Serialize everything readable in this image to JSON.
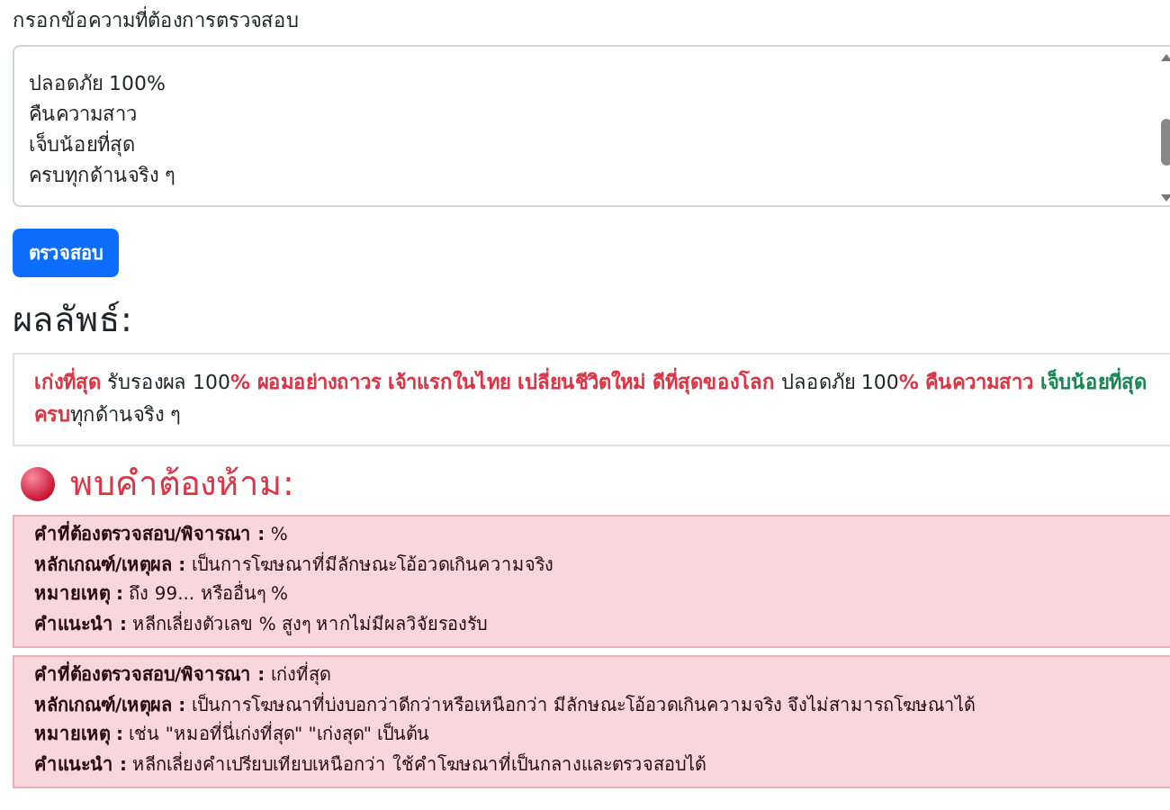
{
  "input": {
    "label": "กรอกข้อความที่ต้องการตรวจสอบ",
    "lines": [
      "ปลอดภัย 100%",
      "คืนความสาว",
      "เจ็บน้อยที่สุด",
      "ครบทุกด้านจริง ๆ"
    ]
  },
  "check_button": "ตรวจสอบ",
  "result": {
    "heading": "ผลลัพธ์:",
    "segments": [
      {
        "text": "เก่งที่สุด",
        "kind": "forbidden"
      },
      {
        "text": " รับรองผล 100",
        "kind": "plain"
      },
      {
        "text": "% ผอมอย่างถาวร เจ้าแรกในไทย เปลี่ยนชีวิตใหม่ ดีที่สุดของโลก",
        "kind": "forbidden"
      },
      {
        "text": " ปลอดภัย 100",
        "kind": "plain"
      },
      {
        "text": "% คืนความสาว",
        "kind": "forbidden"
      },
      {
        "text": " เจ็บน้อยที่สุด",
        "kind": "caution"
      },
      {
        "text": " ครบ",
        "kind": "forbidden"
      },
      {
        "text": "ทุกด้านจริง ๆ",
        "kind": "plain"
      }
    ]
  },
  "findings": {
    "heading": "พบคำต้องห้าม:",
    "items": [
      {
        "fields": [
          {
            "label": "คำที่ต้องตรวจสอบ/พิจารณา :",
            "value": "%"
          },
          {
            "label": "หลักเกณฑ์/เหตุผล :",
            "value": "เป็นการโฆษณาที่มีลักษณะโอ้อวดเกินความจริง"
          },
          {
            "label": "หมายเหตุ :",
            "value": "ถึง 99... หรืออื่นๆ %"
          },
          {
            "label": "คำแนะนำ :",
            "value": "หลีกเลี่ยงตัวเลข % สูงๆ หากไม่มีผลวิจัยรองรับ"
          }
        ]
      },
      {
        "fields": [
          {
            "label": "คำที่ต้องตรวจสอบ/พิจารณา :",
            "value": "เก่งที่สุด"
          },
          {
            "label": "หลักเกณฑ์/เหตุผล :",
            "value": "เป็นการโฆษณาที่บ่งบอกว่าดีกว่าหรือเหนือกว่า มีลักษณะโอ้อวดเกินความจริง จึงไม่สามารถโฆษณาได้"
          },
          {
            "label": "หมายเหตุ :",
            "value": "เช่น \"หมอที่นี่เก่งที่สุด\" \"เก่งสุด\" เป็นต้น"
          },
          {
            "label": "คำแนะนำ :",
            "value": "หลีกเลี่ยงคำเปรียบเทียบเหนือกว่า ใช้คำโฆษณาที่เป็นกลางและตรวจสอบได้"
          }
        ]
      }
    ]
  }
}
